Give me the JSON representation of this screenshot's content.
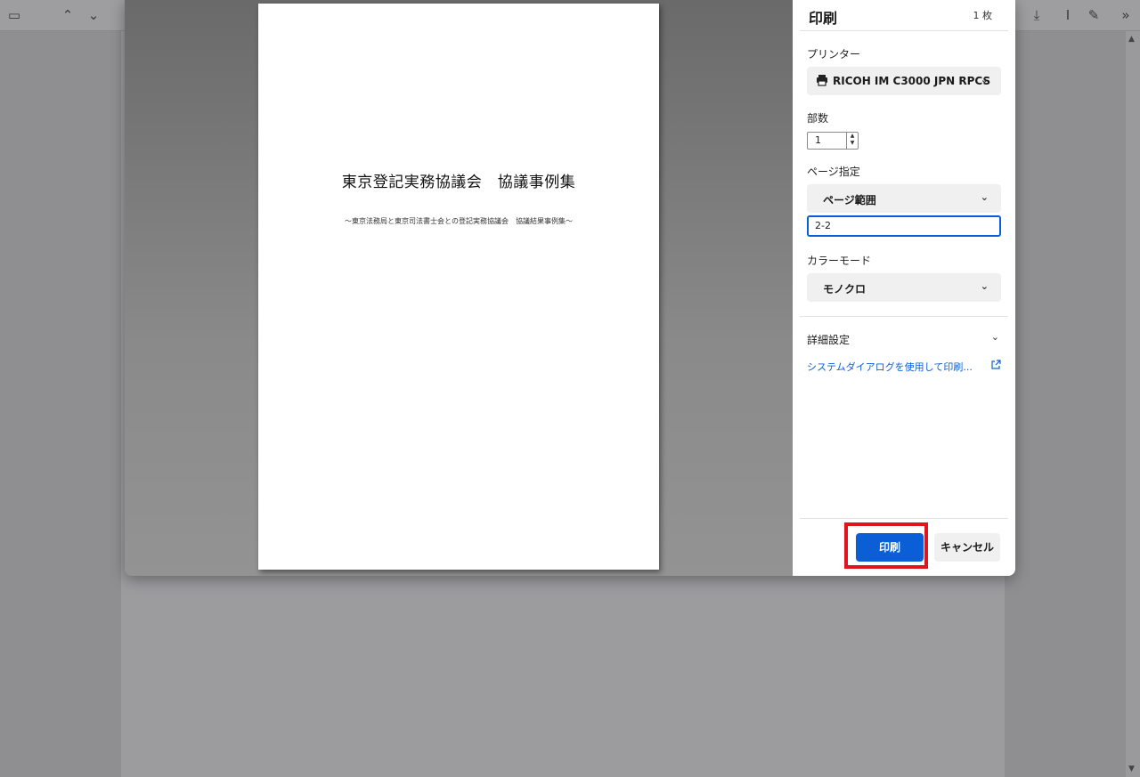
{
  "toolbar": {
    "icons": [
      "sidebar-icon",
      "chevron-up-icon",
      "chevron-down-icon",
      "save-icon",
      "text-select-icon",
      "draw-icon",
      "more-icon"
    ]
  },
  "preview": {
    "title": "東京登記実務協議会　協議事例集",
    "subtitle": "～東京法務局と東京司法書士会との登記実務協議会　協議結果事例集～"
  },
  "panel": {
    "title": "印刷",
    "sheet_count": "1 枚",
    "printer_label": "プリンター",
    "printer_value": "RICOH IM C3000 JPN RPCS",
    "copies_label": "部数",
    "copies_value": "1",
    "pages_label": "ページ指定",
    "pages_value": "ページ範囲",
    "range_value": "2-2",
    "color_label": "カラーモード",
    "color_value": "モノクロ",
    "more_settings": "詳細設定",
    "system_dialog": "システムダイアログを使用して印刷...",
    "print_button": "印刷",
    "cancel_button": "キャンセル"
  },
  "colors": {
    "accent": "#0a5fd6",
    "highlight": "#e0141e"
  }
}
